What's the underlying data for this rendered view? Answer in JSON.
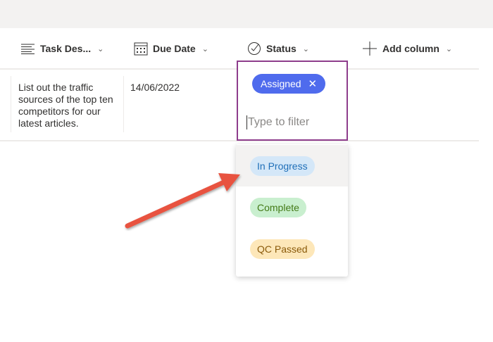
{
  "columns": [
    {
      "label": "Task Des...",
      "icon": "text-lines-icon"
    },
    {
      "label": "Due Date",
      "icon": "calendar-icon"
    },
    {
      "label": "Status",
      "icon": "check-circle-icon"
    },
    {
      "label": "Add column",
      "icon": "plus-icon"
    }
  ],
  "row": {
    "task": "List out the traffic sources of the top ten competitors for our latest articles.",
    "due": "14/06/2022"
  },
  "filter": {
    "selected": "Assigned",
    "placeholder": "Type to filter"
  },
  "options": [
    {
      "label": "In Progress",
      "bg": "#d4e7f8",
      "fg": "#1f6fb8"
    },
    {
      "label": "Complete",
      "bg": "#c9efcf",
      "fg": "#437a17"
    },
    {
      "label": "QC Passed",
      "bg": "#fde7b9",
      "fg": "#8a5a0a"
    }
  ],
  "colors": {
    "accent": "#4f6bed",
    "border": "#8e3d8c",
    "arrow": "#e8523f"
  }
}
